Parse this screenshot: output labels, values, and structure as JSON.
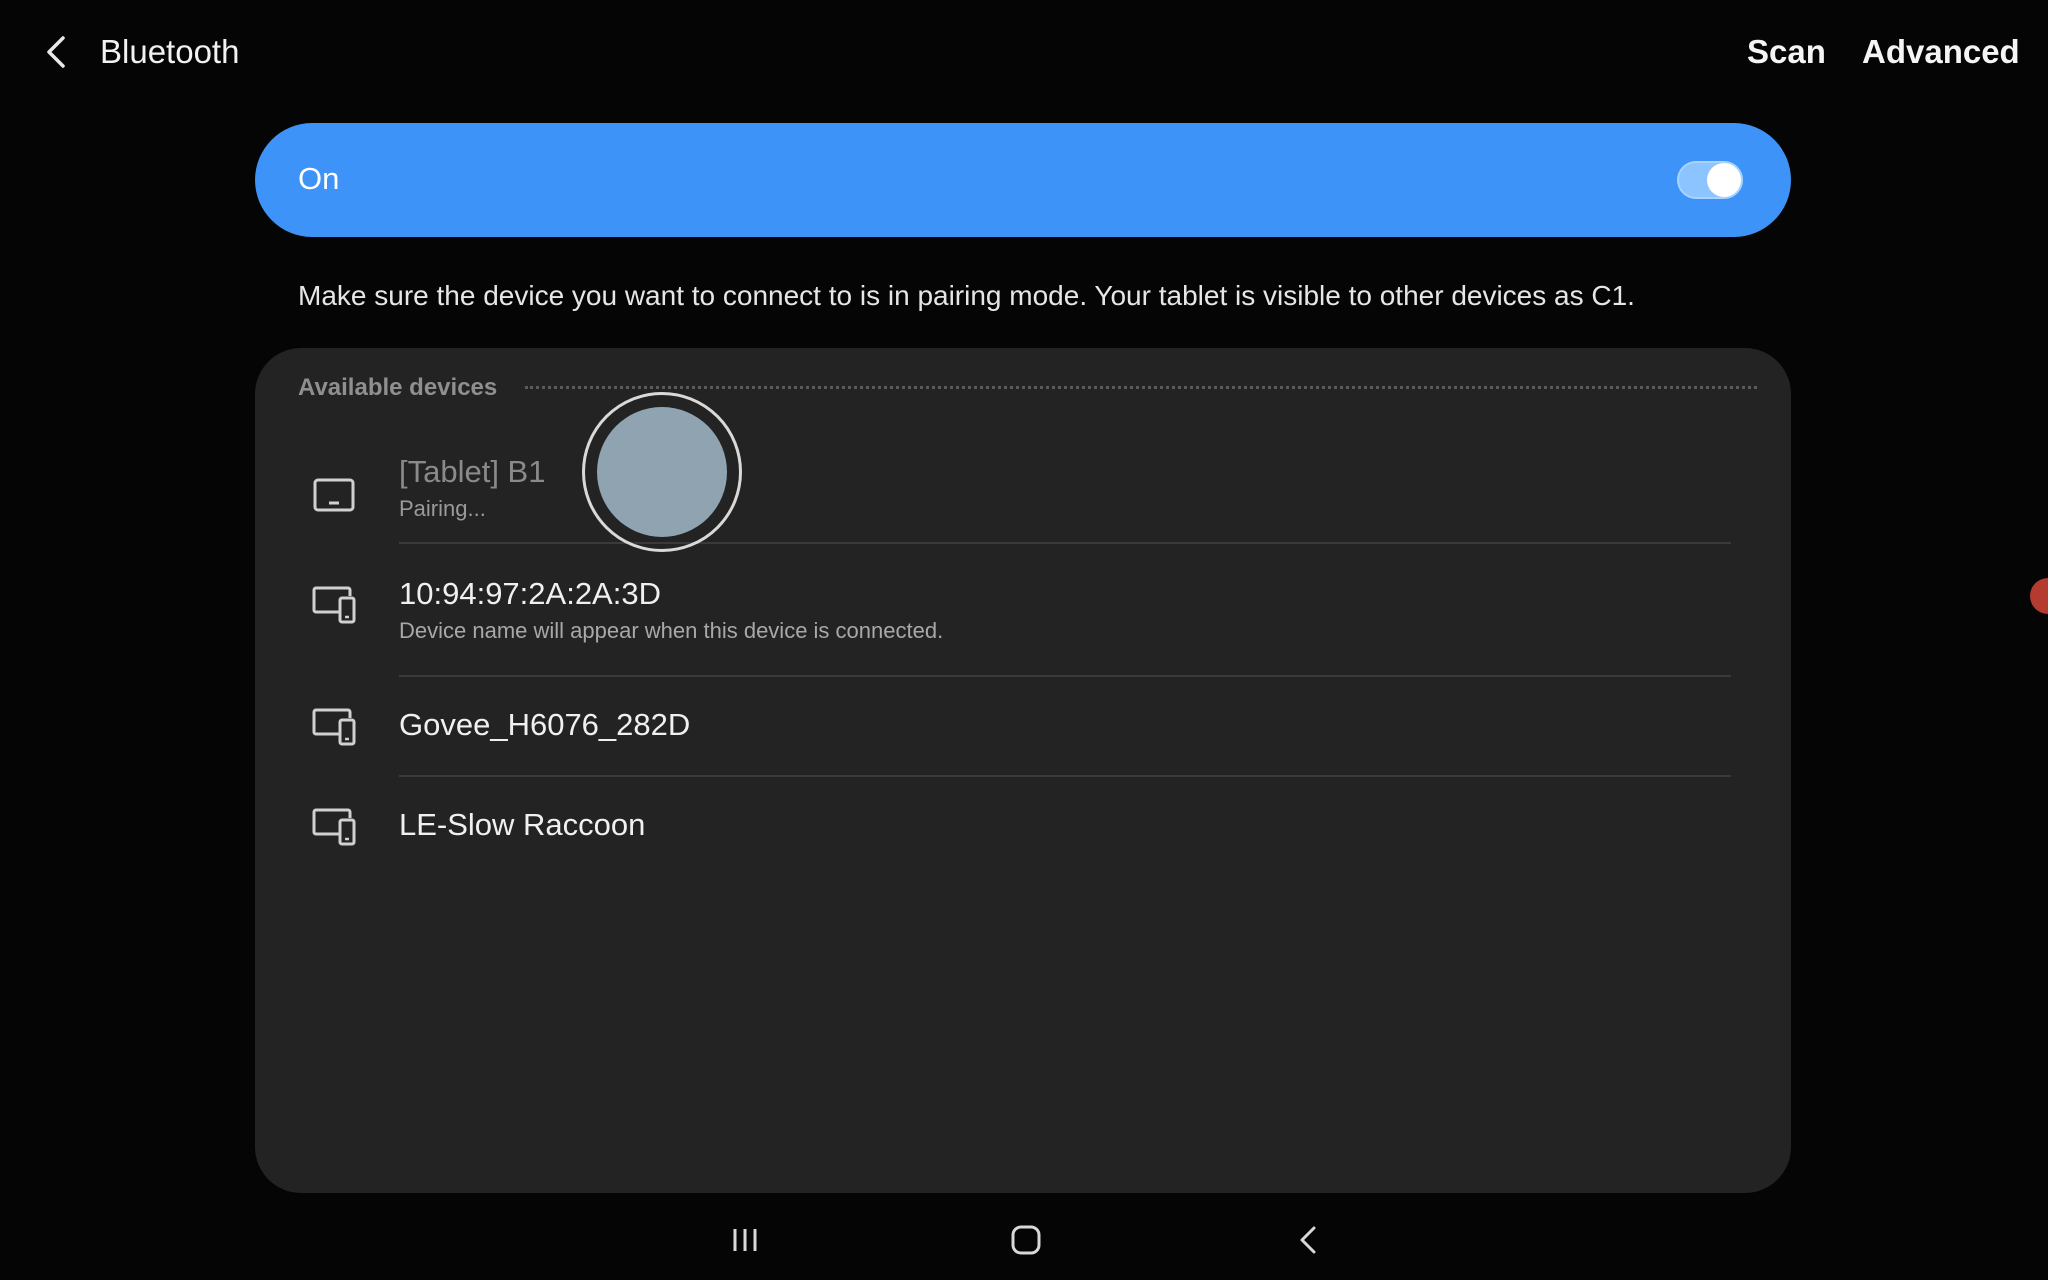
{
  "header": {
    "title": "Bluetooth",
    "scan_label": "Scan",
    "advanced_label": "Advanced"
  },
  "toggle": {
    "label": "On",
    "state": "on",
    "accent_color": "#3d93f7"
  },
  "description": "Make sure the device you want to connect to is in pairing mode. Your tablet is visible to other devices as C1.",
  "available": {
    "header": "Available devices",
    "devices": [
      {
        "name": "[Tablet] B1",
        "subtitle": "Pairing...",
        "icon": "tablet-icon"
      },
      {
        "name": "10:94:97:2A:2A:3D",
        "subtitle": "Device name will appear when this device is connected.",
        "icon": "devices-icon"
      },
      {
        "name": "Govee_H6076_282D",
        "subtitle": "",
        "icon": "devices-icon"
      },
      {
        "name": "LE-Slow Raccoon",
        "subtitle": "",
        "icon": "devices-icon"
      }
    ]
  },
  "navbar": {
    "icons": [
      "recents-icon",
      "home-icon",
      "nav-back-icon"
    ]
  }
}
